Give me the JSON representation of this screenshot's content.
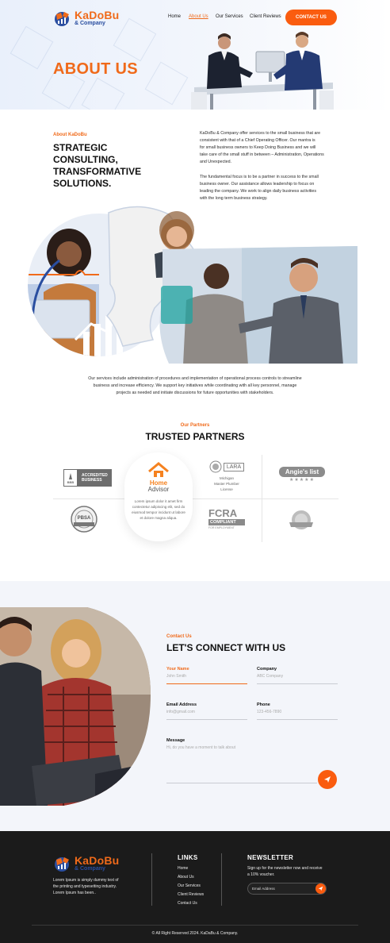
{
  "brand": {
    "name": "KaDoBu",
    "sub": "& Company",
    "colors": {
      "orange": "#fa5c0f",
      "blue": "#2a4ea0",
      "dark": "#1b1b1b"
    }
  },
  "nav": {
    "items": [
      "Home",
      "About Us",
      "Our Services",
      "Client Reviews"
    ],
    "active": "About Us",
    "cta": "CONTACT US"
  },
  "hero": {
    "title": "ABOUT US"
  },
  "about": {
    "kicker": "About KaDoBu",
    "heading_lines": [
      "STRATEGIC",
      "CONSULTING,",
      "TRANSFORMATIVE",
      "SOLUTIONS."
    ],
    "para1_lines": [
      "KaDoBu & Company offer services to the small business that are",
      "consistent with that of a Chief Operating Officer. Our mantra is",
      "for small business owners to Keep Doing Business and we will",
      "take care of the small stuff in between – Administration, Operations",
      "and Unexpected."
    ],
    "para2_lines": [
      "The fundamental focus is to be a partner in success to the small",
      "business owner. Our assistance allows leadership to focus on",
      "leading the company. We work to align daily business activities",
      "with the long term business strategy."
    ],
    "summary_lines": [
      "Our services include administration of procedures and implementation of operational process controls to streamline",
      "business and increase efficiency. We support key initiatives while coordinating with all key personnel, manage",
      "projects as needed and initiate discussions for future opportunities with stakeholders."
    ]
  },
  "partners": {
    "kicker": "Our Partners",
    "heading": "TRUSTED PARTNERS",
    "bbb": {
      "line1": "ACCREDITED",
      "line2": "BUSINESS",
      "mark": "BBB"
    },
    "homeadvisor": {
      "name1": "Home",
      "name2": "Advisor",
      "text_lines": [
        "Lorem ipsum dolor it amet firm",
        "contectetur adipiscing elit, sed do",
        "eiusmod tempor incidunt ut labore",
        "et dolore magna aliqua."
      ]
    },
    "lara": {
      "mark": "LARA",
      "line1": "Michigan",
      "line2": "Master Plumber",
      "line3": "License"
    },
    "angies": {
      "name": "Angie's list",
      "stars": "★★★★★"
    },
    "pbsa": {
      "mark": "PBSA"
    },
    "fcra": {
      "mark": "FCRA",
      "line1": "COMPLIANT",
      "line2": "FOR EMPLOYMENT"
    }
  },
  "contact": {
    "kicker": "Contact Us",
    "heading": "LET'S CONNECT WITH US",
    "fields": {
      "name": {
        "label": "Your Name",
        "placeholder": "John Smith"
      },
      "company": {
        "label": "Company",
        "placeholder": "ABC Company"
      },
      "email": {
        "label": "Email Address",
        "placeholder": "info@gmail.com"
      },
      "phone": {
        "label": "Phone",
        "placeholder": "123-456-7890"
      },
      "message": {
        "label": "Message",
        "placeholder": "Hi, do you have a moment to talk about"
      }
    }
  },
  "footer": {
    "about_lines": [
      "Lorem Ipsum is simply dummy text of",
      "the printing and typesetting industry.",
      "Lorem Ipsum has been.."
    ],
    "links_heading": "LINKS",
    "links": [
      "Home",
      "About Us",
      "Our Services",
      "Client Reviews",
      "Contact Us"
    ],
    "newsletter_heading": "NEWSLETTER",
    "newsletter_lines": [
      "Sign up for the newsletter now and receive",
      "a 10% voucher."
    ],
    "email_placeholder": "Email Address",
    "copyright": "© All Right Reserved 2024. KaDaBu & Company."
  }
}
